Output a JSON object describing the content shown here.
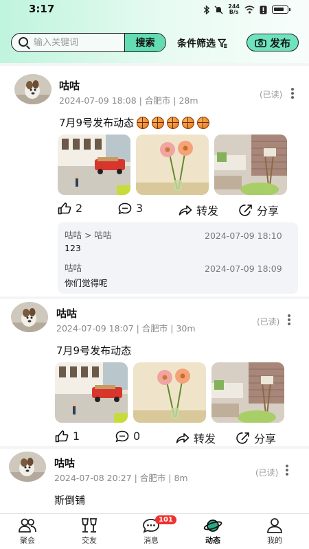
{
  "status_bar": {
    "time": "3:17",
    "net_speed_value": "244",
    "net_speed_unit": "B/s"
  },
  "search": {
    "placeholder": "输入关键词",
    "button_label": "搜索"
  },
  "filter_label": "条件筛选",
  "publish_label": "发布",
  "posts": [
    {
      "author": "咕咕",
      "meta": "2024-07-09 18:08 | 合肥市 | 28m",
      "read_status": "(已读)",
      "content": "7月9号发布动态",
      "emoji_count": 5,
      "likes": "2",
      "comments_count": "3",
      "share_label": "转发",
      "forward_label": "分享",
      "comments": [
        {
          "name": "咕咕 > 咕咕",
          "time": "2024-07-09 18:10",
          "text": "123"
        },
        {
          "name": "咕咕",
          "time": "2024-07-09 18:09",
          "text": "你们觉得呢"
        }
      ]
    },
    {
      "author": "咕咕",
      "meta": "2024-07-09 18:07 | 合肥市 | 30m",
      "read_status": "(已读)",
      "content": "7月9号发布动态",
      "likes": "1",
      "comments_count": "0",
      "share_label": "转发",
      "forward_label": "分享"
    },
    {
      "author": "咕咕",
      "meta": "2024-07-08 20:27 | 合肥市 | 8m",
      "read_status": "(已读)",
      "content": "斯倒铺"
    }
  ],
  "nav": {
    "items": [
      {
        "label": "聚会",
        "icon": "people-icon"
      },
      {
        "label": "交友",
        "icon": "cheers-icon"
      },
      {
        "label": "消息",
        "icon": "chat-icon",
        "badge": "101"
      },
      {
        "label": "动态",
        "icon": "planet-icon"
      },
      {
        "label": "我的",
        "icon": "person-icon"
      }
    ]
  },
  "colors": {
    "accent": "#63dcb4",
    "publish": "#6ee4be",
    "badge": "#f0302f"
  }
}
